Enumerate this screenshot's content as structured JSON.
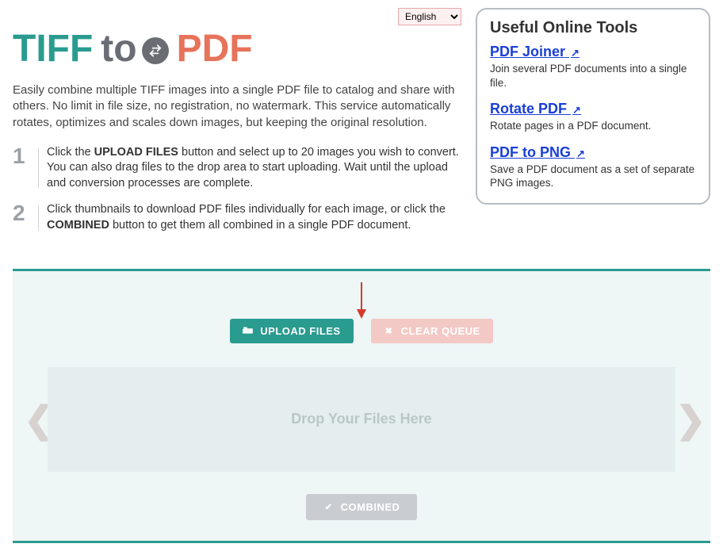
{
  "language": {
    "selected": "English"
  },
  "logo": {
    "word1": "TIFF",
    "word2": "to",
    "word3": "PDF"
  },
  "intro": "Easily combine multiple TIFF images into a single PDF file to catalog and share with others. No limit in file size, no registration, no watermark. This service automatically rotates, optimizes and scales down images, but keeping the original resolution.",
  "steps": [
    {
      "num": "1",
      "parts": [
        "Click the ",
        "UPLOAD FILES",
        " button and select up to 20 images you wish to convert. You can also drag files to the drop area to start uploading. Wait until the upload and conversion processes are complete."
      ]
    },
    {
      "num": "2",
      "parts": [
        "Click thumbnails to download PDF files individually for each image, or click the ",
        "COMBINED",
        " button to get them all combined in a single PDF document."
      ]
    }
  ],
  "sidebar": {
    "title": "Useful Online Tools",
    "items": [
      {
        "name": "PDF Joiner",
        "desc": "Join several PDF documents into a single file."
      },
      {
        "name": "Rotate PDF",
        "desc": "Rotate pages in a PDF document."
      },
      {
        "name": "PDF to PNG",
        "desc": "Save a PDF document as a set of separate PNG images."
      }
    ]
  },
  "buttons": {
    "upload": "UPLOAD FILES",
    "clear": "CLEAR QUEUE",
    "combined": "COMBINED"
  },
  "dropzone": {
    "placeholder": "Drop Your Files Here"
  },
  "nav": {
    "prev": "❮",
    "next": "❯"
  },
  "icons": {
    "folder": "📂",
    "close": "✖",
    "check": "✔",
    "ext": "↗",
    "swap": "⇄"
  },
  "colors": {
    "teal": "#2a9b8f",
    "coral": "#e6735a",
    "gray": "#6a6e74"
  }
}
